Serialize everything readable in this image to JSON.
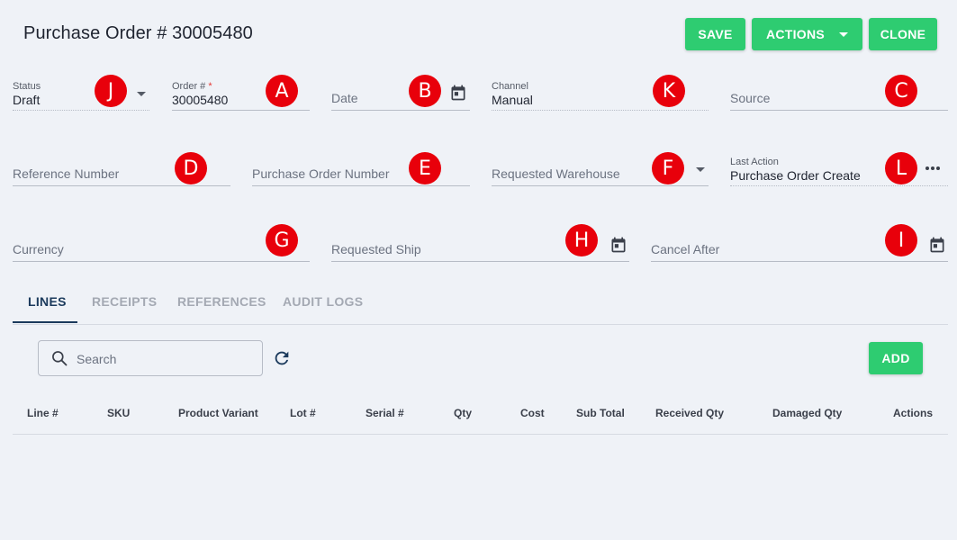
{
  "header": {
    "title": "Purchase Order # 30005480",
    "save_label": "SAVE",
    "actions_label": "ACTIONS",
    "clone_label": "CLONE"
  },
  "fields": {
    "status": {
      "label": "Status",
      "value": "Draft",
      "badge": "J"
    },
    "order_number": {
      "label": "Order #",
      "required_mark": "*",
      "value": "30005480",
      "badge": "A"
    },
    "date": {
      "placeholder": "Date",
      "badge": "B"
    },
    "channel": {
      "label": "Channel",
      "value": "Manual",
      "badge": "K"
    },
    "source": {
      "placeholder": "Source",
      "badge": "C"
    },
    "reference_number": {
      "placeholder": "Reference Number",
      "badge": "D"
    },
    "purchase_order_number": {
      "placeholder": "Purchase Order Number",
      "badge": "E"
    },
    "requested_warehouse": {
      "placeholder": "Requested Warehouse",
      "badge": "F"
    },
    "last_action": {
      "label": "Last Action",
      "value": "Purchase Order Create",
      "badge": "L"
    },
    "currency": {
      "placeholder": "Currency",
      "badge": "G"
    },
    "requested_ship": {
      "placeholder": "Requested Ship",
      "badge": "H"
    },
    "cancel_after": {
      "placeholder": "Cancel After",
      "badge": "I"
    }
  },
  "tabs": [
    {
      "label": "LINES",
      "active": true
    },
    {
      "label": "RECEIPTS",
      "active": false
    },
    {
      "label": "REFERENCES",
      "active": false
    },
    {
      "label": "AUDIT LOGS",
      "active": false
    }
  ],
  "lines": {
    "search_placeholder": "Search",
    "add_label": "ADD",
    "columns": [
      "Line #",
      "SKU",
      "Product Variant",
      "Lot #",
      "Serial #",
      "Qty",
      "Cost",
      "Sub Total",
      "Received Qty",
      "Damaged Qty",
      "Actions"
    ]
  },
  "colors": {
    "accent": "#2ecc71",
    "badge": "#e8000b",
    "active_tab": "#1b3a5c",
    "background": "#eff2f7"
  }
}
